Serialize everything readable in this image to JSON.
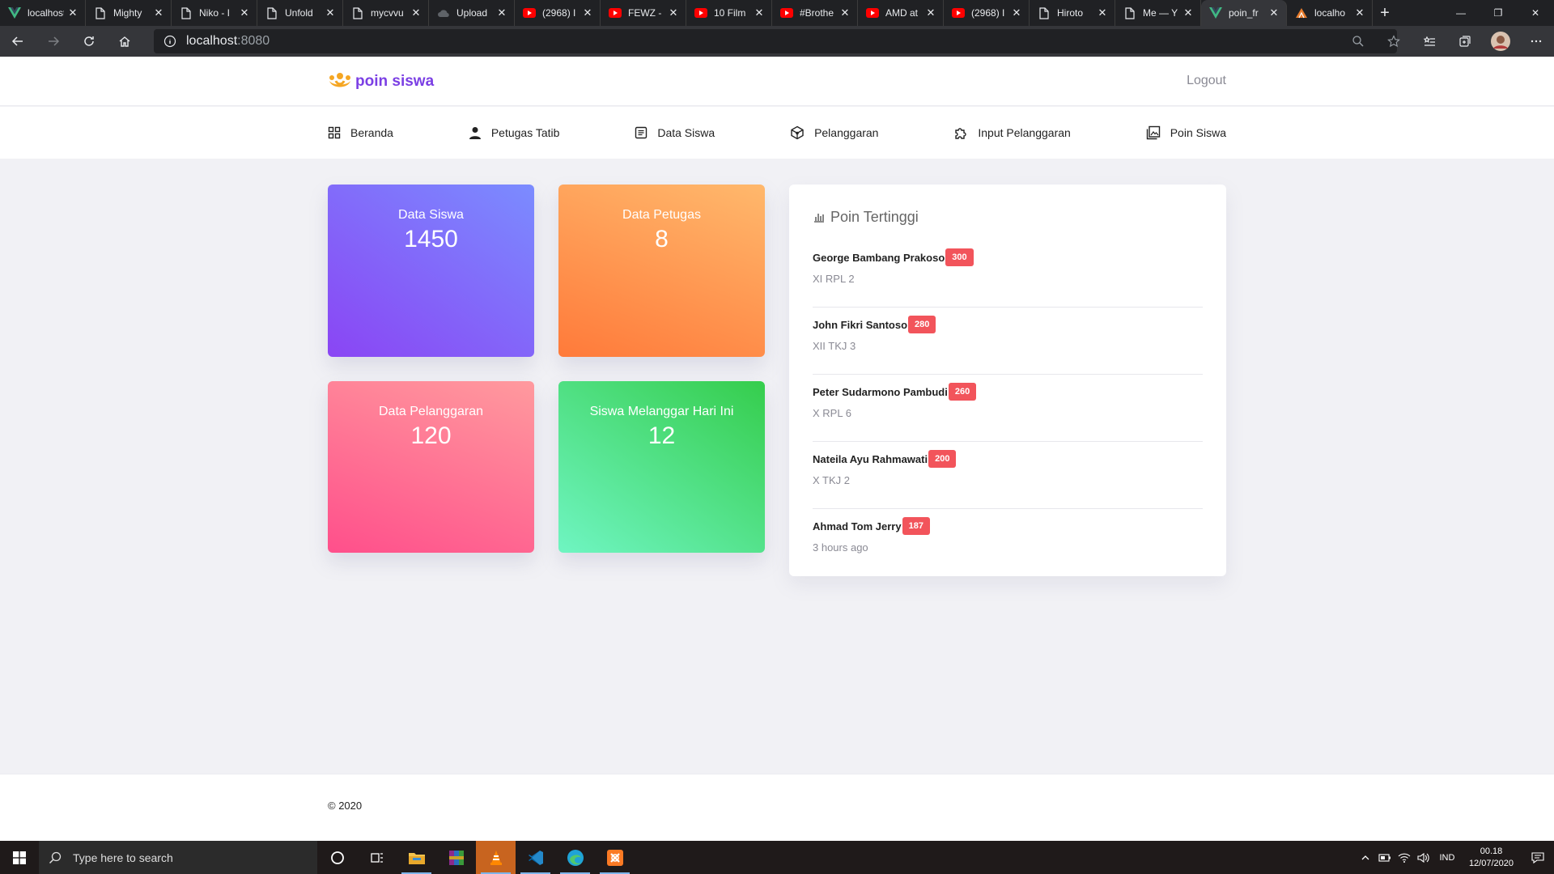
{
  "browser": {
    "tabs": [
      {
        "title": "localhost",
        "icon": "vue-icon"
      },
      {
        "title": "Mighty",
        "icon": "page-icon"
      },
      {
        "title": "Niko - I",
        "icon": "page-icon"
      },
      {
        "title": "Unfold",
        "icon": "page-icon"
      },
      {
        "title": "mycvvu",
        "icon": "page-icon"
      },
      {
        "title": "Upload",
        "icon": "cloud-icon"
      },
      {
        "title": "(2968) I",
        "icon": "youtube-icon"
      },
      {
        "title": "FEWZ -",
        "icon": "youtube-icon"
      },
      {
        "title": "10 Film",
        "icon": "youtube-icon"
      },
      {
        "title": "#Brothe",
        "icon": "youtube-icon"
      },
      {
        "title": "AMD at",
        "icon": "youtube-icon"
      },
      {
        "title": "(2968) I",
        "icon": "youtube-icon"
      },
      {
        "title": "Hiroto",
        "icon": "page-icon"
      },
      {
        "title": "Me — Y",
        "icon": "page-icon"
      },
      {
        "title": "poin_fr",
        "icon": "vue-icon"
      },
      {
        "title": "localho",
        "icon": "xampp-icon"
      }
    ],
    "active_tab_index": 14,
    "url_host": "localhost",
    "url_port": ":8080"
  },
  "app": {
    "brand": "poin siswa",
    "logout_label": "Logout",
    "menu": [
      {
        "label": "Beranda",
        "icon": "grid-icon"
      },
      {
        "label": "Petugas Tatib",
        "icon": "user-icon"
      },
      {
        "label": "Data Siswa",
        "icon": "document-icon"
      },
      {
        "label": "Pelanggaran",
        "icon": "cube-icon"
      },
      {
        "label": "Input Pelanggaran",
        "icon": "puzzle-icon"
      },
      {
        "label": "Poin Siswa",
        "icon": "image-icon"
      }
    ],
    "cards": [
      {
        "label": "Data Siswa",
        "value": "1450"
      },
      {
        "label": "Data Petugas",
        "value": "8"
      },
      {
        "label": "Data Pelanggaran",
        "value": "120"
      },
      {
        "label": "Siswa Melanggar Hari Ini",
        "value": "12"
      }
    ],
    "ranking": {
      "title": "Poin Tertinggi",
      "items": [
        {
          "name": "George Bambang Prakoso",
          "points": "300",
          "sub": "XI RPL 2"
        },
        {
          "name": "John Fikri Santoso",
          "points": "280",
          "sub": "XII TKJ 3"
        },
        {
          "name": "Peter Sudarmono Pambudi",
          "points": "260",
          "sub": "X RPL 6"
        },
        {
          "name": "Nateila Ayu Rahmawati",
          "points": "200",
          "sub": "X TKJ 2"
        },
        {
          "name": "Ahmad Tom Jerry",
          "points": "187",
          "sub": "3 hours ago"
        }
      ]
    },
    "footer": "© 2020"
  },
  "taskbar": {
    "search_placeholder": "Type here to search",
    "language": "IND",
    "time": "00.18",
    "date": "12/07/2020"
  },
  "colors": {
    "brand": "#7b3fe4",
    "badge": "#f2545b"
  }
}
